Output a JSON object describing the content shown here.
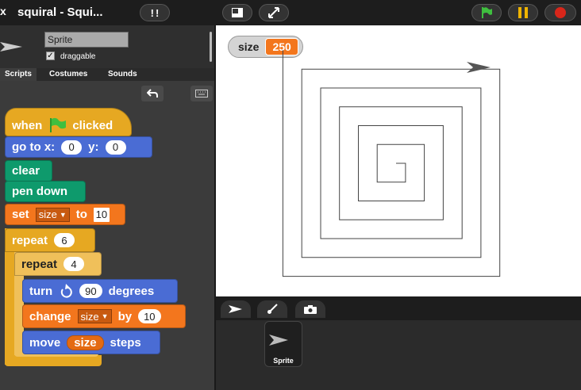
{
  "window": {
    "logo_glyph": "x",
    "title": "squiral - Squi..."
  },
  "toolbar": {
    "icons": [
      "cloud-turbo-icon",
      "stage-size-icon",
      "fullscreen-icon",
      "green-flag-icon",
      "pause-icon",
      "stop-icon"
    ],
    "colors": {
      "flag": "#3fbf3f",
      "pause": "#f0b400",
      "stop": "#d8261a"
    }
  },
  "sprite_corner": {
    "name_value": "Sprite",
    "draggable_label": "draggable",
    "draggable_checked": "✓"
  },
  "tabs": [
    {
      "label": "Scripts",
      "active": true
    },
    {
      "label": "Costumes",
      "active": false
    },
    {
      "label": "Sounds",
      "active": false
    }
  ],
  "scripts": {
    "hat": {
      "when": "when",
      "clicked": "clicked"
    },
    "goto": {
      "label": "go to x:",
      "x": "0",
      "y_label": "y:",
      "y": "0"
    },
    "clear": "clear",
    "pen_down": "pen down",
    "set": {
      "label": "set",
      "var": "size",
      "to": "to",
      "value": "10"
    },
    "repeat_outer": {
      "label": "repeat",
      "count": "6"
    },
    "repeat_inner": {
      "label": "repeat",
      "count": "4"
    },
    "turn": {
      "label": "turn",
      "value": "90",
      "unit": "degrees"
    },
    "change": {
      "label": "change",
      "var": "size",
      "by": "by",
      "value": "10"
    },
    "move": {
      "label": "move",
      "var": "size",
      "unit": "steps"
    },
    "colors": {
      "motion": "#4a6cd4",
      "pen": "#0e9a6c",
      "variables": "#f3761d",
      "control": "#e6a822"
    }
  },
  "stage": {
    "watcher": {
      "label": "size",
      "value": "250"
    }
  },
  "corral": {
    "tab_icons": [
      "turtle-arrow-icon",
      "paint-brush-icon",
      "camera-icon"
    ],
    "sprite_label": "Sprite"
  }
}
